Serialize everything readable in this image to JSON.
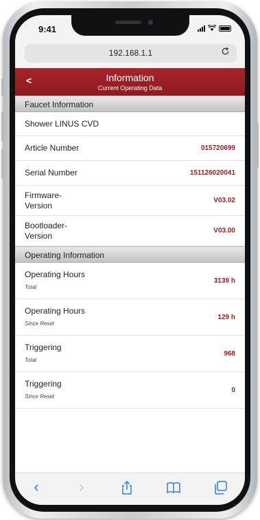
{
  "status": {
    "time": "9:41"
  },
  "browser": {
    "url": "192.168.1.1",
    "reload_icon": "reload-icon"
  },
  "header": {
    "back_label": "<",
    "title": "Information",
    "subtitle": "Current Operating Data"
  },
  "faucet_section": {
    "title": "Faucet Information",
    "name": "Shower LINUS CVD",
    "rows": [
      {
        "label": "Article Number",
        "value": "015720699"
      },
      {
        "label": "Serial Number",
        "value": "151126020041"
      }
    ],
    "version_rows": [
      {
        "label_line1": "Firmware-",
        "label_line2": "Version",
        "value": "V03.02"
      },
      {
        "label_line1": "Bootloader-",
        "label_line2": "Version",
        "value": "V03.00"
      }
    ]
  },
  "operating_section": {
    "title": "Operating Information",
    "rows": [
      {
        "label": "Operating Hours",
        "sub": "Total",
        "value": "3139 h"
      },
      {
        "label": "Operating Hours",
        "sub": "Since Reset",
        "value": "129 h"
      },
      {
        "label": "Triggering",
        "sub": "Total",
        "value": "968"
      },
      {
        "label": "Triggering",
        "sub": "Since Reset",
        "value": "0"
      }
    ]
  },
  "toolbar": {
    "icons": [
      "back-icon",
      "forward-icon",
      "share-icon",
      "bookmarks-icon",
      "tabs-icon"
    ],
    "back_glyph": "‹",
    "forward_glyph": "›"
  },
  "colors": {
    "header_red": "#9a1c22",
    "value_red": "#9a1c22",
    "ios_blue": "#2f7bf5"
  }
}
